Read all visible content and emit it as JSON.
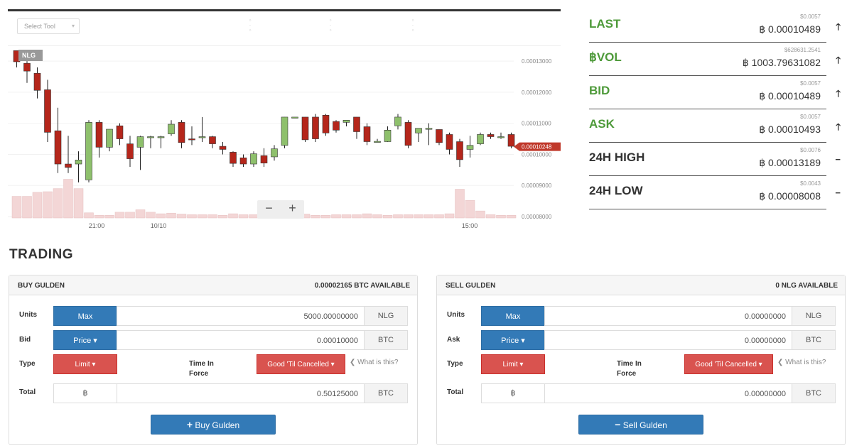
{
  "chart": {
    "toolbar": {
      "select_tool": "Select Tool",
      "caret": "▾"
    },
    "symbol_tag": "NLG",
    "price_ticks": [
      "0.00013000",
      "0.00012000",
      "0.00011000",
      "0.00010000",
      "0.00009000",
      "0.00008000"
    ],
    "current_price": "0.00010248",
    "x_ticks": [
      "21:00",
      "10/10",
      "15:00"
    ],
    "zoom_out": "−",
    "zoom_in": "+",
    "colors": {
      "up": "#8ec06c",
      "down": "#b5261b",
      "volume": "#f3d6d6",
      "current": "#c0392b"
    }
  },
  "chart_data": {
    "type": "candlestick",
    "ylim": [
      8e-05,
      0.000133
    ],
    "candles": [
      {
        "o": 0.0001334,
        "h": 0.0001334,
        "c": 0.0001298,
        "l": 0.000128
      },
      {
        "o": 0.0001293,
        "h": 0.00013,
        "c": 0.0001268,
        "l": 0.000123
      },
      {
        "o": 0.0001261,
        "h": 0.000128,
        "c": 0.0001206,
        "l": 0.000118
      },
      {
        "o": 0.0001208,
        "h": 0.000124,
        "c": 0.0001071,
        "l": 0.000104
      },
      {
        "o": 0.0001076,
        "h": 0.000115,
        "c": 9.69e-05,
        "l": 9.4e-05
      },
      {
        "o": 9.69e-05,
        "h": 0.000106,
        "c": 9.58e-05,
        "l": 9.4e-05
      },
      {
        "o": 9.69e-05,
        "h": 0.000101,
        "c": 9.82e-05,
        "l": 9.1e-05
      },
      {
        "o": 9.18e-05,
        "h": 0.000111,
        "c": 0.0001103,
        "l": 9.1e-05
      },
      {
        "o": 0.0001103,
        "h": 0.000111,
        "c": 0.0001023,
        "l": 9.9e-05
      },
      {
        "o": 0.0001023,
        "h": 0.000108,
        "c": 0.0001081,
        "l": 0.000101
      },
      {
        "o": 0.0001092,
        "h": 0.00011,
        "c": 0.000105,
        "l": 0.000103
      },
      {
        "o": 0.0001034,
        "h": 0.000106,
        "c": 9.86e-05,
        "l": 9.6e-05
      },
      {
        "o": 0.0001023,
        "h": 0.000106,
        "c": 0.0001057,
        "l": 9.5e-05
      },
      {
        "o": 0.0001057,
        "h": 0.000106,
        "c": 0.0001057,
        "l": 0.000102
      },
      {
        "o": 0.0001057,
        "h": 0.000106,
        "c": 0.0001057,
        "l": 0.000102
      },
      {
        "o": 0.0001066,
        "h": 0.000111,
        "c": 0.0001097,
        "l": 0.000106
      },
      {
        "o": 0.0001103,
        "h": 0.000111,
        "c": 0.0001038,
        "l": 0.000102
      },
      {
        "o": 0.000105,
        "h": 0.000109,
        "c": 0.0001047,
        "l": 0.000103
      },
      {
        "o": 0.0001057,
        "h": 0.000112,
        "c": 0.0001057,
        "l": 0.000104
      },
      {
        "o": 0.0001057,
        "h": 0.000106,
        "c": 0.0001034,
        "l": 0.000102
      },
      {
        "o": 0.0001026,
        "h": 0.000104,
        "c": 0.0001016,
        "l": 0.0001
      },
      {
        "o": 0.0001007,
        "h": 0.000101,
        "c": 9.71e-05,
        "l": 9.6e-05
      },
      {
        "o": 9.89e-05,
        "h": 0.0001,
        "c": 9.69e-05,
        "l": 9.6e-05
      },
      {
        "o": 9.69e-05,
        "h": 0.000101,
        "c": 0.0001002,
        "l": 9.6e-05
      },
      {
        "o": 9.96e-05,
        "h": 0.000102,
        "c": 9.72e-05,
        "l": 9.6e-05
      },
      {
        "o": 9.92e-05,
        "h": 0.000103,
        "c": 0.0001018,
        "l": 9.8e-05
      },
      {
        "o": 0.0001029,
        "h": 0.000112,
        "c": 0.000112,
        "l": 0.000102
      },
      {
        "o": 0.000112,
        "h": 0.000112,
        "c": 0.000112,
        "l": 0.000112
      },
      {
        "o": 0.000112,
        "h": 0.000112,
        "c": 0.0001047,
        "l": 0.000104
      },
      {
        "o": 0.000112,
        "h": 0.000113,
        "c": 0.000105,
        "l": 0.000104
      },
      {
        "o": 0.0001126,
        "h": 0.000113,
        "c": 0.0001069,
        "l": 0.000106
      },
      {
        "o": 0.0001106,
        "h": 0.000111,
        "c": 0.0001078,
        "l": 0.000107
      },
      {
        "o": 0.0001103,
        "h": 0.000111,
        "c": 0.000111,
        "l": 0.000109
      },
      {
        "o": 0.000112,
        "h": 0.000112,
        "c": 0.0001073,
        "l": 0.000105
      },
      {
        "o": 0.0001089,
        "h": 0.00011,
        "c": 0.0001041,
        "l": 0.000103
      },
      {
        "o": 0.0001042,
        "h": 0.000105,
        "c": 0.0001042,
        "l": 0.000104
      },
      {
        "o": 0.0001041,
        "h": 0.000109,
        "c": 0.0001078,
        "l": 0.000104
      },
      {
        "o": 0.0001092,
        "h": 0.000113,
        "c": 0.000112,
        "l": 0.000108
      },
      {
        "o": 0.0001103,
        "h": 0.000111,
        "c": 0.0001029,
        "l": 0.000102
      },
      {
        "o": 0.0001069,
        "h": 0.000107,
        "c": 0.0001084,
        "l": 0.000104
      },
      {
        "o": 0.0001084,
        "h": 0.00011,
        "c": 0.0001084,
        "l": 0.000103
      },
      {
        "o": 0.000108,
        "h": 0.000108,
        "c": 0.0001038,
        "l": 0.000103
      },
      {
        "o": 0.0001064,
        "h": 0.000107,
        "c": 0.0001016,
        "l": 0.0001
      },
      {
        "o": 0.0001041,
        "h": 0.000105,
        "c": 9.83e-05,
        "l": 9.6e-05
      },
      {
        "o": 0.0001016,
        "h": 0.000106,
        "c": 0.0001029,
        "l": 9.9e-05
      },
      {
        "o": 0.0001034,
        "h": 0.000107,
        "c": 0.0001064,
        "l": 0.000103
      },
      {
        "o": 0.0001064,
        "h": 0.000107,
        "c": 0.0001057,
        "l": 0.000105
      },
      {
        "o": 0.0001057,
        "h": 0.000107,
        "c": 0.0001057,
        "l": 0.000105
      },
      {
        "o": 0.0001064,
        "h": 0.000107,
        "c": 0.0001026,
        "l": 0.000102
      }
    ],
    "volume": [
      8.65e-05,
      8.65e-05,
      8.78e-05,
      8.8e-05,
      8.9e-05,
      9.2e-05,
      8.9e-05,
      8.12e-05,
      8.04e-05,
      8.04e-05,
      8.14e-05,
      8.14e-05,
      8.22e-05,
      8.14e-05,
      8.09e-05,
      8.11e-05,
      8.08e-05,
      8.06e-05,
      8.06e-05,
      8.06e-05,
      8.04e-05,
      8.09e-05,
      8.06e-05,
      8.06e-05,
      8.08e-05,
      8.06e-05,
      8.06e-05,
      8.06e-05,
      8.08e-05,
      8.04e-05,
      8.04e-05,
      8.06e-05,
      8.06e-05,
      8.06e-05,
      8.09e-05,
      8.06e-05,
      8.04e-05,
      8.06e-05,
      8.06e-05,
      8.06e-05,
      8.06e-05,
      8.06e-05,
      8.09e-05,
      8.88e-05,
      8.52e-05,
      8.18e-05,
      8.06e-05,
      8.04e-05,
      8.04e-05
    ]
  },
  "ticker": [
    {
      "label": "LAST",
      "color": "#4e9a3a",
      "usd": "$0.0057",
      "value": "฿ 0.00010489",
      "arrow": "🡑"
    },
    {
      "label": "฿VOL",
      "color": "#4e9a3a",
      "usd": "$628631.2541",
      "value": "฿ 1003.79631082",
      "arrow": "🡑"
    },
    {
      "label": "BID",
      "color": "#4e9a3a",
      "usd": "$0.0057",
      "value": "฿ 0.00010489",
      "arrow": "🡑"
    },
    {
      "label": "ASK",
      "color": "#4e9a3a",
      "usd": "$0.0057",
      "value": "฿ 0.00010493",
      "arrow": "🡑"
    },
    {
      "label": "24H HIGH",
      "color": "#333333",
      "usd": "$0.0076",
      "value": "฿ 0.00013189",
      "arrow": "−"
    },
    {
      "label": "24H LOW",
      "color": "#333333",
      "usd": "$0.0043",
      "value": "฿ 0.00008008",
      "arrow": "−"
    }
  ],
  "trading": {
    "title": "TRADING",
    "buy": {
      "title": "BUY GULDEN",
      "available": "0.00002165 BTC AVAILABLE",
      "units_label": "Units",
      "units_btn": "Max",
      "units_value": "5000.00000000",
      "units_addon": "NLG",
      "price_label": "Bid",
      "price_btn": "Price ▾",
      "price_value": "0.00010000",
      "price_addon": "BTC",
      "type_label": "Type",
      "type_btn": "Limit ▾",
      "tif_label": "Time In Force",
      "tif_btn": "Good 'Til Cancelled ▾",
      "whatis": "❮ What is this?",
      "total_label": "Total",
      "total_symbol": "฿",
      "total_value": "0.50125000",
      "total_addon": "BTC",
      "action_icon": "+",
      "action_label": "Buy Gulden"
    },
    "sell": {
      "title": "SELL GULDEN",
      "available": "0 NLG AVAILABLE",
      "units_label": "Units",
      "units_btn": "Max",
      "units_value": "0.00000000",
      "units_addon": "NLG",
      "price_label": "Ask",
      "price_btn": "Price ▾",
      "price_value": "0.00000000",
      "price_addon": "BTC",
      "type_label": "Type",
      "type_btn": "Limit ▾",
      "tif_label": "Time In Force",
      "tif_btn": "Good 'Til Cancelled ▾",
      "whatis": "❮ What is this?",
      "total_label": "Total",
      "total_symbol": "฿",
      "total_value": "0.00000000",
      "total_addon": "BTC",
      "action_icon": "−",
      "action_label": "Sell Gulden"
    }
  }
}
